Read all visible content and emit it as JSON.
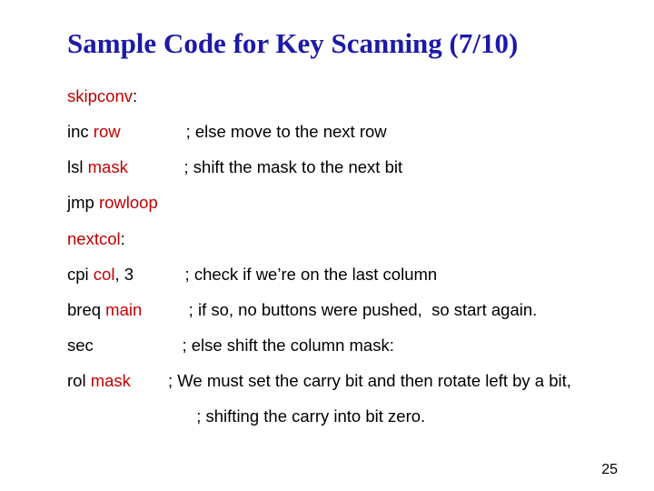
{
  "title": "Sample Code for Key Scanning (7/10)",
  "lines": [
    {
      "parts": [
        {
          "t": "skipconv",
          "red": true
        },
        {
          "t": ":",
          "red": false
        }
      ]
    },
    {
      "parts": [
        {
          "t": "inc ",
          "red": false
        },
        {
          "t": "row",
          "red": true
        },
        {
          "t": "              ; else move to the next row",
          "red": false
        }
      ]
    },
    {
      "parts": [
        {
          "t": "lsl ",
          "red": false
        },
        {
          "t": "mask",
          "red": true
        },
        {
          "t": "            ; shift the mask to the next bit",
          "red": false
        }
      ]
    },
    {
      "parts": [
        {
          "t": "jmp ",
          "red": false
        },
        {
          "t": "rowloop",
          "red": true
        }
      ]
    },
    {
      "parts": [
        {
          "t": "nextcol",
          "red": true
        },
        {
          "t": ":",
          "red": false
        }
      ]
    },
    {
      "parts": [
        {
          "t": "cpi ",
          "red": false
        },
        {
          "t": "col",
          "red": true
        },
        {
          "t": ", 3           ; check if we’re on the last column",
          "red": false
        }
      ]
    },
    {
      "parts": [
        {
          "t": "breq ",
          "red": false
        },
        {
          "t": "main",
          "red": true
        },
        {
          "t": "          ; if so, no buttons were pushed,  so start again.",
          "red": false
        }
      ]
    },
    {
      "parts": [
        {
          "t": "sec                   ; else shift the column mask:",
          "red": false
        }
      ]
    },
    {
      "wrap": true,
      "parts": [
        {
          "t": "rol ",
          "red": false
        },
        {
          "t": "mask",
          "red": true
        },
        {
          "t": "        ; We must set the carry bit and then rotate left by a bit,",
          "red": false
        }
      ]
    },
    {
      "indent": true,
      "parts": [
        {
          "t": "                ; shifting the carry into bit zero.",
          "red": false
        }
      ]
    }
  ],
  "pagenum": "25"
}
